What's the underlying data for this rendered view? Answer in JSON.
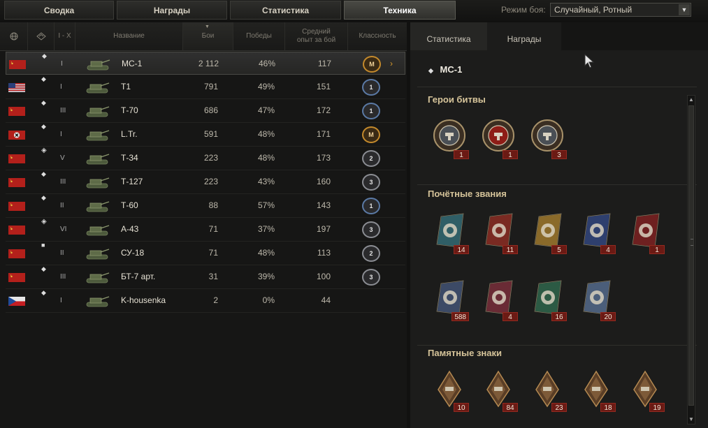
{
  "top_tabs": [
    "Сводка",
    "Награды",
    "Статистика",
    "Техника"
  ],
  "battle_mode": {
    "label": "Режим боя:",
    "value": "Случайный, Ротный"
  },
  "table": {
    "headers": {
      "nation": "globe-icon",
      "type": "tank-type-icon",
      "tier": "I - X",
      "name": "Название",
      "battles": "Бои",
      "wins": "Победы",
      "avg_xp": "Средний опыт за бой",
      "mastery": "Классность"
    },
    "rows": [
      {
        "flag": "ussr",
        "type_icon": "light",
        "tier": "I",
        "name": "МС-1",
        "battles": "2 112",
        "wins": "46%",
        "avg_xp": "117",
        "mastery": "M"
      },
      {
        "flag": "usa",
        "type_icon": "light",
        "tier": "I",
        "name": "T1",
        "battles": "791",
        "wins": "49%",
        "avg_xp": "151",
        "mastery": "1"
      },
      {
        "flag": "ussr",
        "type_icon": "light",
        "tier": "III",
        "name": "Т-70",
        "battles": "686",
        "wins": "47%",
        "avg_xp": "172",
        "mastery": "1"
      },
      {
        "flag": "germany",
        "type_icon": "light",
        "tier": "I",
        "name": "L.Tr.",
        "battles": "591",
        "wins": "48%",
        "avg_xp": "171",
        "mastery": "M"
      },
      {
        "flag": "ussr",
        "type_icon": "medium",
        "tier": "V",
        "name": "Т-34",
        "battles": "223",
        "wins": "48%",
        "avg_xp": "173",
        "mastery": "2"
      },
      {
        "flag": "ussr",
        "type_icon": "light",
        "tier": "III",
        "name": "Т-127",
        "battles": "223",
        "wins": "43%",
        "avg_xp": "160",
        "mastery": "3"
      },
      {
        "flag": "ussr",
        "type_icon": "light",
        "tier": "II",
        "name": "Т-60",
        "battles": "88",
        "wins": "57%",
        "avg_xp": "143",
        "mastery": "1"
      },
      {
        "flag": "ussr",
        "type_icon": "medium",
        "tier": "VI",
        "name": "А-43",
        "battles": "71",
        "wins": "37%",
        "avg_xp": "197",
        "mastery": "3"
      },
      {
        "flag": "ussr",
        "type_icon": "spg",
        "tier": "II",
        "name": "СУ-18",
        "battles": "71",
        "wins": "48%",
        "avg_xp": "113",
        "mastery": "2"
      },
      {
        "flag": "ussr",
        "type_icon": "light",
        "tier": "III",
        "name": "БТ-7 арт.",
        "battles": "31",
        "wins": "39%",
        "avg_xp": "100",
        "mastery": "3"
      },
      {
        "flag": "czech",
        "type_icon": "light",
        "tier": "I",
        "name": "K-housenka",
        "battles": "2",
        "wins": "0%",
        "avg_xp": "44",
        "mastery": ""
      }
    ]
  },
  "right_tabs": [
    "Статистика",
    "Награды"
  ],
  "vehicle": {
    "name": "МС-1"
  },
  "sections": {
    "heroes": {
      "title": "Герои битвы",
      "awards": [
        {
          "icon": "warrior-medal-icon",
          "count": "1"
        },
        {
          "icon": "defender-medal-icon",
          "count": "1"
        },
        {
          "icon": "tank-sniper-medal-icon",
          "count": "3"
        }
      ]
    },
    "titles": {
      "title": "Почётные звания",
      "awards": [
        {
          "icon": "title-1-icon",
          "count": "14"
        },
        {
          "icon": "title-2-icon",
          "count": "11"
        },
        {
          "icon": "title-3-icon",
          "count": "5"
        },
        {
          "icon": "title-4-icon",
          "count": "4"
        },
        {
          "icon": "title-5-icon",
          "count": "1"
        },
        {
          "icon": "title-6-icon",
          "count": "588"
        },
        {
          "icon": "title-7-icon",
          "count": "4"
        },
        {
          "icon": "title-8-icon",
          "count": "16"
        },
        {
          "icon": "title-9-icon",
          "count": "20"
        }
      ]
    },
    "memorial": {
      "title": "Памятные знаки",
      "awards": [
        {
          "icon": "memorial-1-icon",
          "count": "10"
        },
        {
          "icon": "memorial-2-icon",
          "count": "84"
        },
        {
          "icon": "memorial-3-icon",
          "count": "23"
        },
        {
          "icon": "memorial-4-icon",
          "count": "18"
        },
        {
          "icon": "memorial-5-icon",
          "count": "19"
        }
      ]
    }
  },
  "colors": {
    "accent_gold": "#d6c49a",
    "badge_red": "#6b1a14",
    "flag_red": "#b3201b"
  }
}
